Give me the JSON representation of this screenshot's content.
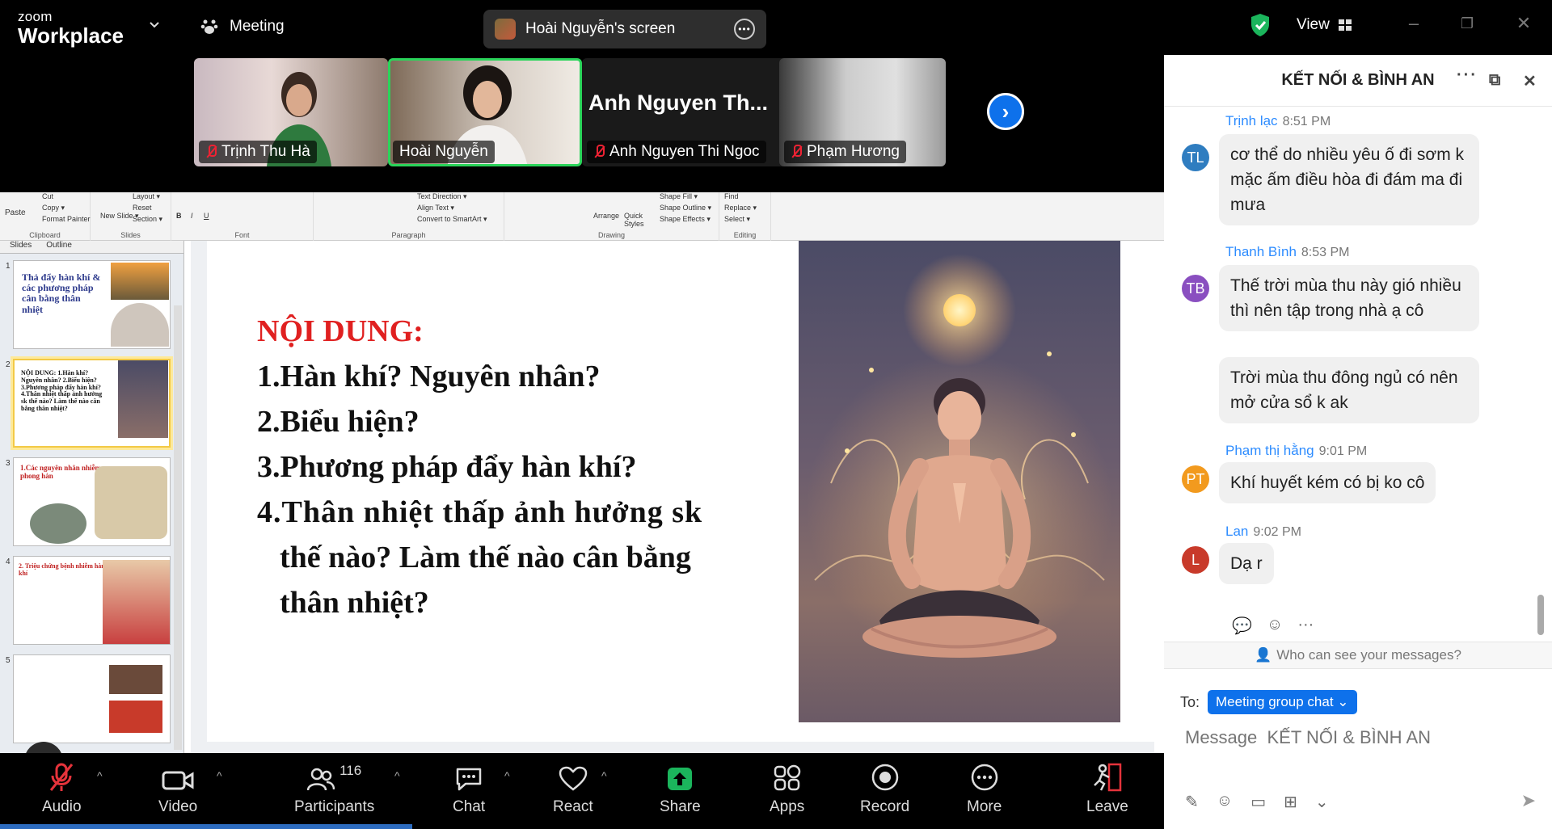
{
  "app": {
    "brand_top": "zoom",
    "brand_bottom": "Workplace"
  },
  "topbar": {
    "meeting_label": "Meeting",
    "screen_label": "Hoài Nguyễn's screen",
    "view_label": "View"
  },
  "participants_strip": [
    {
      "name": "Trịnh Thu Hà",
      "muted": true
    },
    {
      "name": "Hoài Nguyễn",
      "muted": false,
      "active": true
    },
    {
      "name": "Anh Nguyen Thi Ngoc",
      "muted": true,
      "display": "Anh Nguyen Th..."
    },
    {
      "name": "Phạm Hương",
      "muted": true
    }
  ],
  "ppt": {
    "ribbon": {
      "clipboard": {
        "label": "Clipboard",
        "paste": "Paste",
        "cut": "Cut",
        "copy": "Copy ▾",
        "format_painter": "Format Painter"
      },
      "slides": {
        "label": "Slides",
        "new_slide": "New Slide ▾",
        "layout": "Layout ▾",
        "reset": "Reset",
        "section": "Section ▾"
      },
      "font": {
        "label": "Font",
        "bold": "B",
        "italic": "I",
        "underline": "U"
      },
      "paragraph": {
        "label": "Paragraph",
        "text_direction": "Text Direction ▾",
        "align_text": "Align Text ▾",
        "convert": "Convert to SmartArt ▾"
      },
      "drawing": {
        "label": "Drawing",
        "arrange": "Arrange",
        "quick_styles": "Quick Styles",
        "shape_fill": "Shape Fill ▾",
        "shape_outline": "Shape Outline ▾",
        "shape_effects": "Shape Effects ▾"
      },
      "editing": {
        "label": "Editing",
        "find": "Find",
        "replace": "Replace ▾",
        "select": "Select ▾"
      }
    },
    "panel_tabs": [
      "Slides",
      "Outline"
    ],
    "thumbs": [
      {
        "num": "1",
        "text": "Thả đẩy hàn khí & các phương pháp cân bằng thân nhiệt"
      },
      {
        "num": "2",
        "text": "NỘI DUNG: 1.Hàn khí? Nguyên nhân? 2.Biểu hiện? 3.Phương pháp đẩy hàn khí? 4.Thân nhiệt thấp ảnh hưởng sk thế nào? Làm thế nào cân bằng thân nhiệt?"
      },
      {
        "num": "3",
        "text": "1.Các nguyên nhân nhiễm phong hàn"
      },
      {
        "num": "4",
        "text": "2. Triệu chứng bệnh nhiễm hàn khí"
      },
      {
        "num": "5",
        "text": ""
      }
    ],
    "slide": {
      "title": "NỘI DUNG:",
      "lines": [
        "1.Hàn khí? Nguyên nhân?",
        "2.Biểu hiện?",
        "3.Phương pháp đẩy hàn khí?",
        "4.Thân  nhiệt  thấp  ảnh  hưởng  sk",
        "thế  nào?  Làm  thế  nào  cân  bằng",
        "thân nhiệt?"
      ]
    }
  },
  "chat": {
    "title": "KẾT NỐI & BÌNH AN",
    "messages": [
      {
        "initials": "TL",
        "color": "#2f7dc0",
        "sender": "Trịnh lạc",
        "time": "8:51 PM",
        "bubbles": [
          "cơ thể do nhiều yêu ố đi sơm k mặc ấm điều hòa đi đám ma đi mưa"
        ]
      },
      {
        "initials": "TB",
        "color": "#8a4fc0",
        "sender": "Thanh Bình",
        "time": "8:53 PM",
        "bubbles": [
          "Thế trời mùa thu này gió nhiều thì nên tập trong nhà ạ cô",
          "Trời mùa thu đông ngủ có nên mở cửa sổ k ak"
        ]
      },
      {
        "initials": "PT",
        "color": "#f29a1e",
        "sender": "Phạm thị hằng",
        "time": "9:01 PM",
        "bubbles": [
          "Khí huyết kém có bị ko cô"
        ]
      },
      {
        "initials": "L",
        "color": "#c83a2a",
        "sender": "Lan",
        "time": "9:02 PM",
        "bubbles": [
          "Dạ r"
        ]
      }
    ],
    "who_can_see": "Who can see your messages?",
    "to_label": "To:",
    "to_target": "Meeting group chat",
    "input_placeholder": "Message  KẾT NỐI & BÌNH AN"
  },
  "toolbar": {
    "audio": "Audio",
    "video": "Video",
    "participants": "Participants",
    "participants_count": "116",
    "chat": "Chat",
    "react": "React",
    "share": "Share",
    "apps": "Apps",
    "record": "Record",
    "more": "More",
    "leave": "Leave"
  },
  "colors": {
    "accent": "#0e71eb",
    "share_green": "#1bb55c",
    "leave_red": "#e5333b",
    "active_tile": "#2ad45a"
  }
}
